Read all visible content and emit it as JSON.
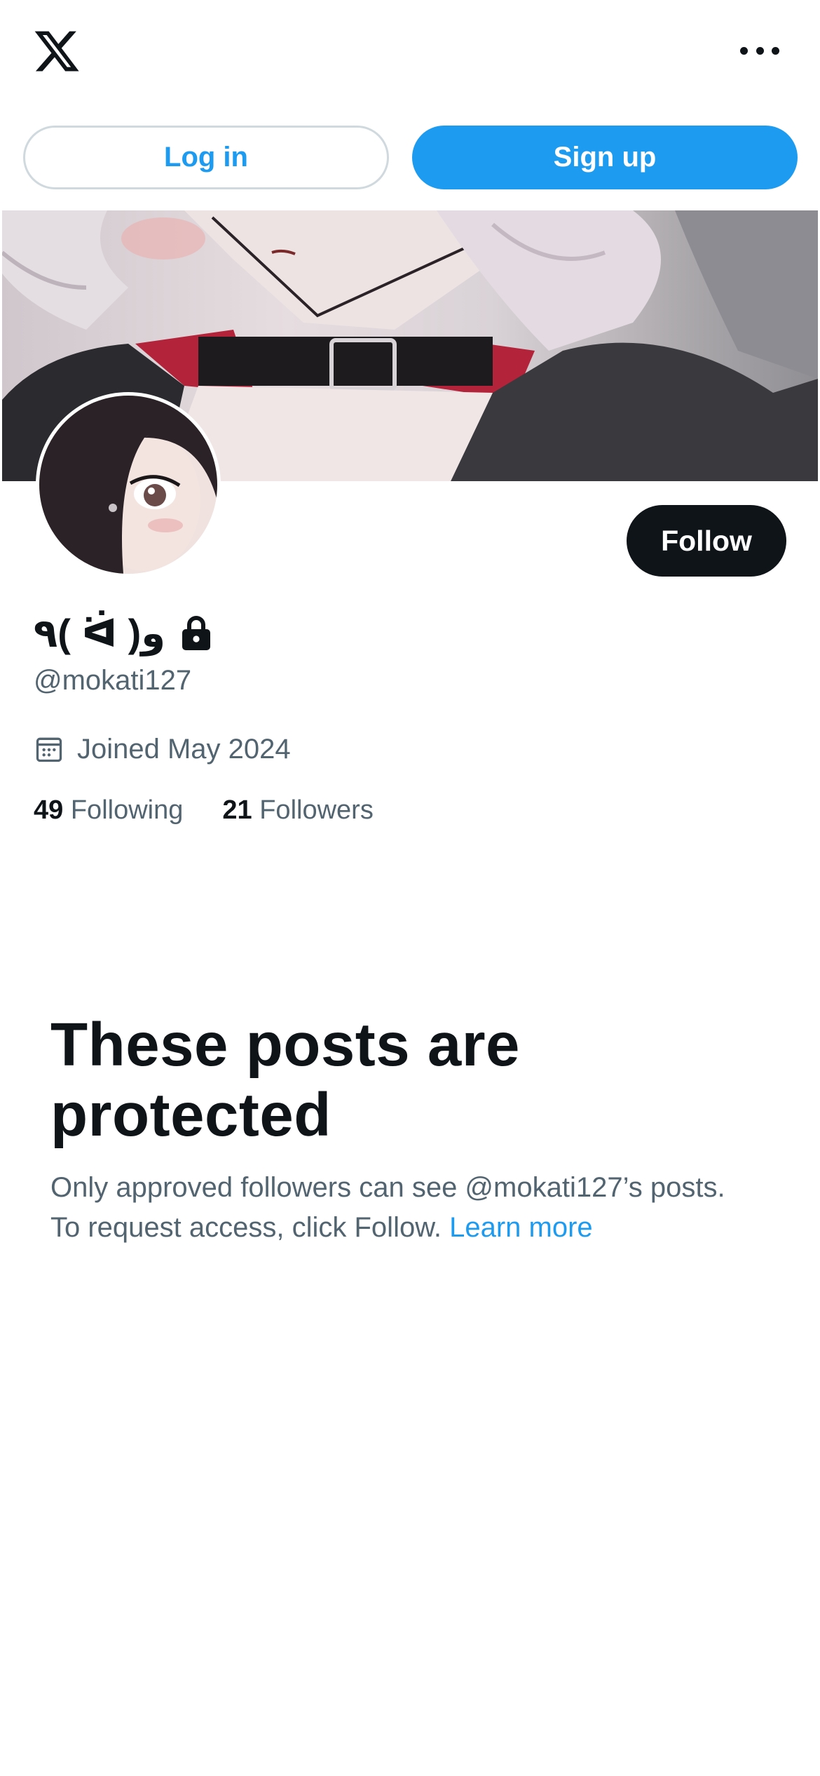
{
  "header": {
    "logo_icon": "x-logo-icon",
    "more_icon": "more-options-icon"
  },
  "auth": {
    "login_label": "Log in",
    "signup_label": "Sign up"
  },
  "profile": {
    "display_name": "٩( ᐛ )و",
    "protected_icon": "lock-icon",
    "handle": "@mokati127",
    "joined": "Joined May 2024",
    "follow_label": "Follow",
    "following_count": "49",
    "following_label": "Following",
    "followers_count": "21",
    "followers_label": "Followers"
  },
  "protected": {
    "title": "These posts are protected",
    "text": "Only approved followers can see @mokati127’s posts. To request access, click Follow.",
    "learn_more": "Learn more"
  },
  "colors": {
    "accent": "#1d9bf0",
    "text_primary": "#0f1419",
    "text_secondary": "#536471",
    "border": "#cfd9de"
  }
}
